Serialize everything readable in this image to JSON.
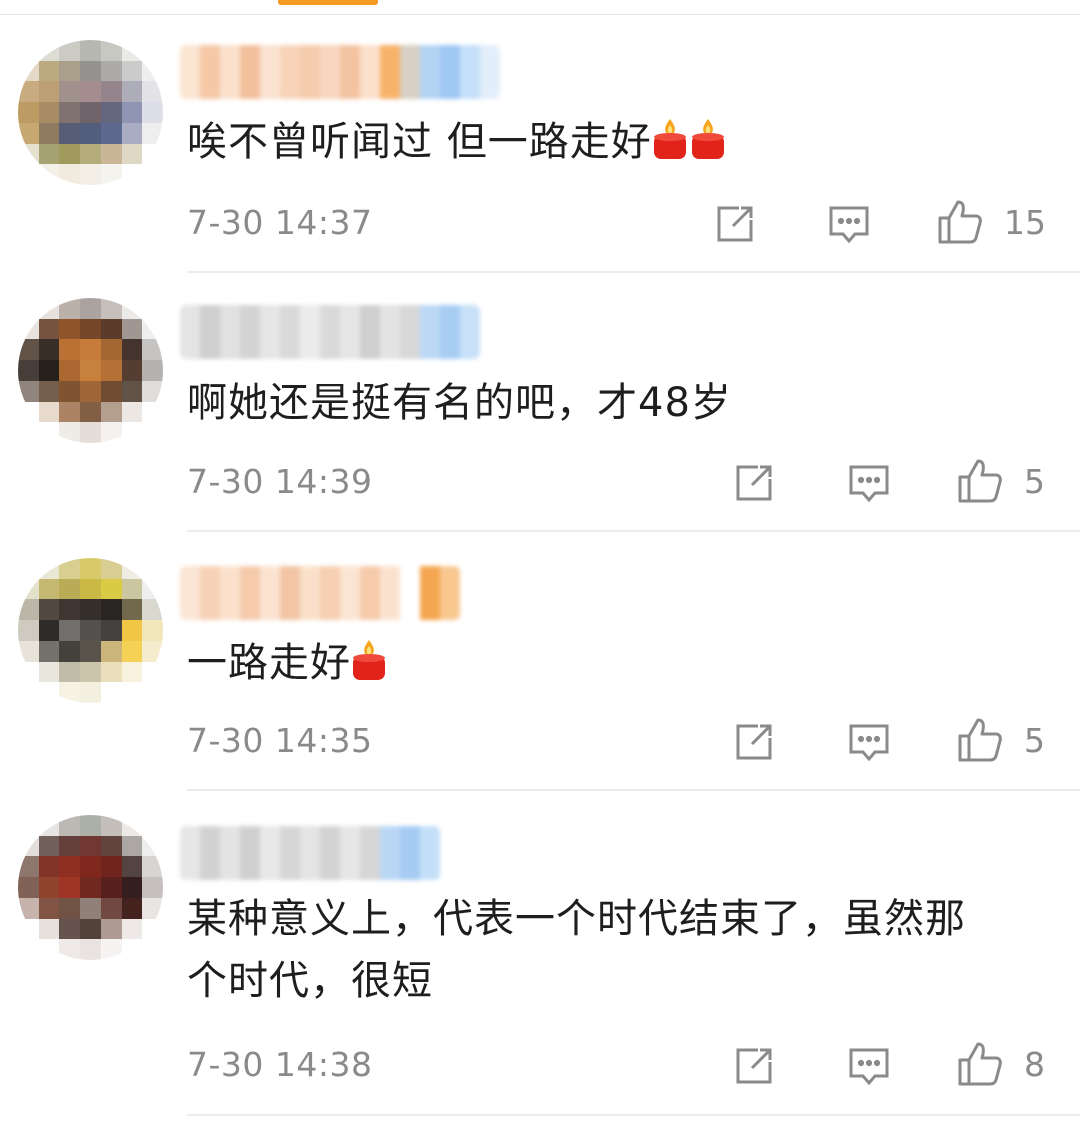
{
  "comments": [
    {
      "text": "唉不曾听闻过 但一路走好",
      "emoji_count": 2,
      "time": "7-30 14:37",
      "likes": "15",
      "icons": [
        "share-icon",
        "comment-icon",
        "like-icon"
      ]
    },
    {
      "text": "啊她还是挺有名的吧，才48岁",
      "emoji_count": 0,
      "time": "7-30 14:39",
      "likes": "5",
      "icons": [
        "share-icon",
        "comment-icon",
        "like-icon"
      ]
    },
    {
      "text": "一路走好",
      "emoji_count": 1,
      "time": "7-30 14:35",
      "likes": "5",
      "icons": [
        "share-icon",
        "comment-icon",
        "like-icon"
      ]
    },
    {
      "text": "某种意义上，代表一个时代结束了，虽然那\n个时代，很短",
      "emoji_count": 0,
      "time": "7-30 14:38",
      "likes": "8",
      "icons": [
        "share-icon",
        "comment-icon",
        "like-icon"
      ]
    }
  ],
  "colors": {
    "accent": "#f59a23",
    "text": "#1e1e1e",
    "meta": "#8a8a8a",
    "icon": "#8a8a8a",
    "divider": "#ececec"
  }
}
